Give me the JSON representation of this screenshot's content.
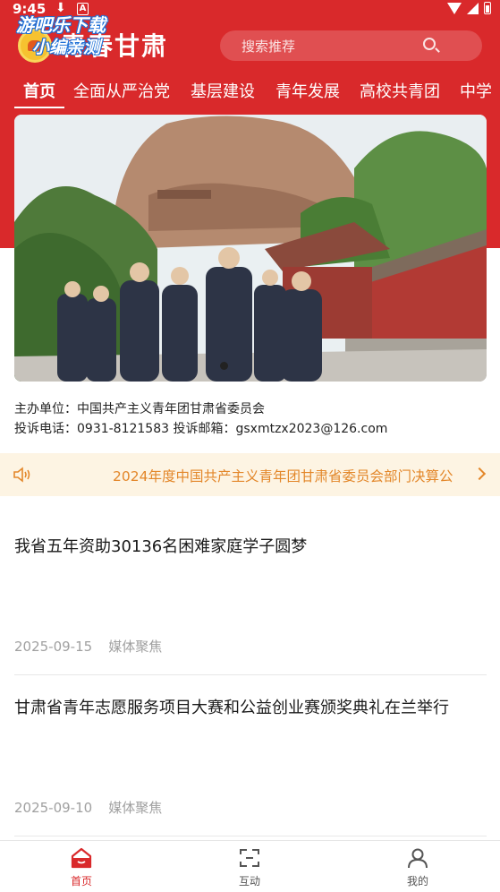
{
  "status_bar": {
    "time": "9:45"
  },
  "watermark": {
    "line1": "游吧乐下载",
    "line2": "小编亲测"
  },
  "header": {
    "app_title": "青春甘肃",
    "search_placeholder": "搜索推荐",
    "accent_color": "#d9292b"
  },
  "tabs": [
    {
      "label": "首页",
      "active": true
    },
    {
      "label": "全面从严治党"
    },
    {
      "label": "基层建设"
    },
    {
      "label": "青年发展"
    },
    {
      "label": "高校共青团"
    },
    {
      "label": "中学"
    }
  ],
  "banner": {
    "image": "leaders-walking-at-scenic-cliff-site",
    "slide_count": 1
  },
  "info": {
    "sponsor_label": "主办单位：",
    "sponsor": "中国共产主义青年团甘肃省委员会",
    "phone_label": "投诉电话：",
    "phone": "0931-8121583",
    "email_label": "投诉邮箱：",
    "email": "gsxmtzx2023@126.com"
  },
  "notice": {
    "text": "2024年度中国共产主义青年团甘肃省委员会部门决算公",
    "color": "#e3872a"
  },
  "news": [
    {
      "title": "我省五年资助30136名困难家庭学子圆梦",
      "date": "2025-09-15",
      "source": "媒体聚焦"
    },
    {
      "title": "甘肃省青年志愿服务项目大赛和公益创业赛颁奖典礼在兰举行",
      "date": "2025-09-10",
      "source": "媒体聚焦"
    }
  ],
  "bottom_nav": [
    {
      "label": "首页",
      "icon": "home-icon",
      "active": true
    },
    {
      "label": "互动",
      "icon": "interact-icon"
    },
    {
      "label": "我的",
      "icon": "user-icon"
    }
  ]
}
